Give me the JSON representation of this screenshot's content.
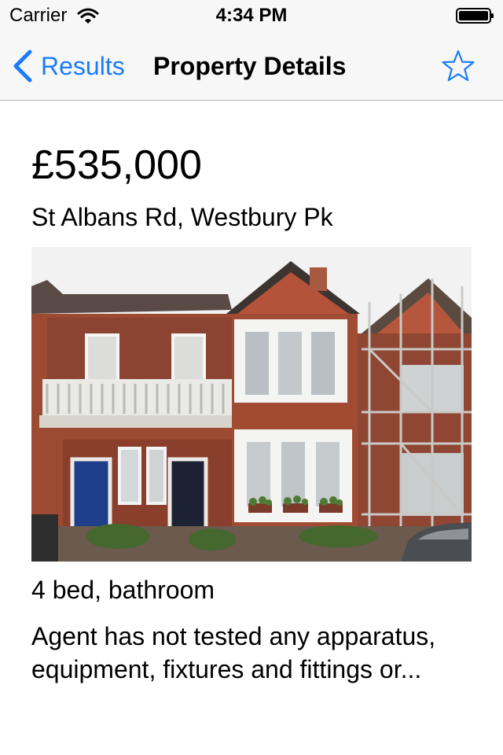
{
  "status_bar": {
    "carrier": "Carrier",
    "time": "4:34 PM",
    "wifi_icon": "wifi-icon",
    "battery_icon": "battery-icon"
  },
  "nav": {
    "back_label": "Results",
    "title": "Property Details",
    "favorite_icon": "star-outline-icon",
    "accent_color": "#1a7cf7"
  },
  "property": {
    "price": "£535,000",
    "address": "St Albans Rd,  Westbury Pk",
    "rooms": "4 bed,  bathroom",
    "summary": "Agent has not tested any apparatus, equipment, fixtures and fittings or..."
  }
}
